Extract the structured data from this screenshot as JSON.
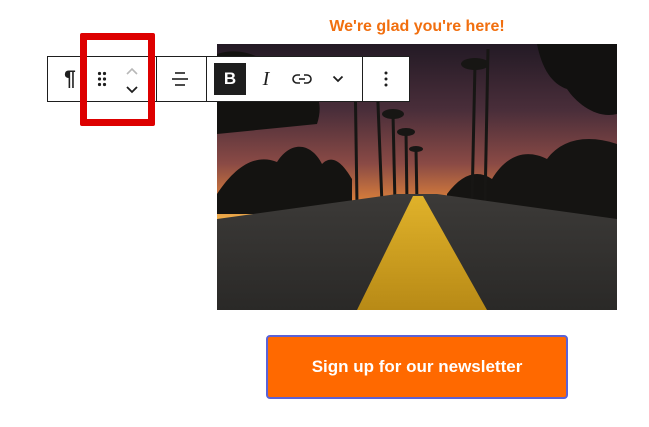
{
  "heading": {
    "text": "We're glad you're here!",
    "color": "#f16f0f"
  },
  "image": {
    "subject": "sunset road with palm trees"
  },
  "toolbar": {
    "paragraph_icon": "pilcrow-icon",
    "paragraph_glyph": "¶",
    "drag_icon": "drag-handle-icon",
    "move_up_icon": "chevron-up-icon",
    "move_down_icon": "chevron-down-icon",
    "align_icon": "align-center-icon",
    "bold_label": "B",
    "italic_label": "I",
    "link_icon": "link-icon",
    "more_formats_icon": "chevron-down-icon",
    "options_icon": "more-vertical-icon"
  },
  "highlight": {
    "color": "#dd0000"
  },
  "cta": {
    "label": "Sign up for our newsletter",
    "color": "#ff6900",
    "border_color": "#5b62d6"
  }
}
